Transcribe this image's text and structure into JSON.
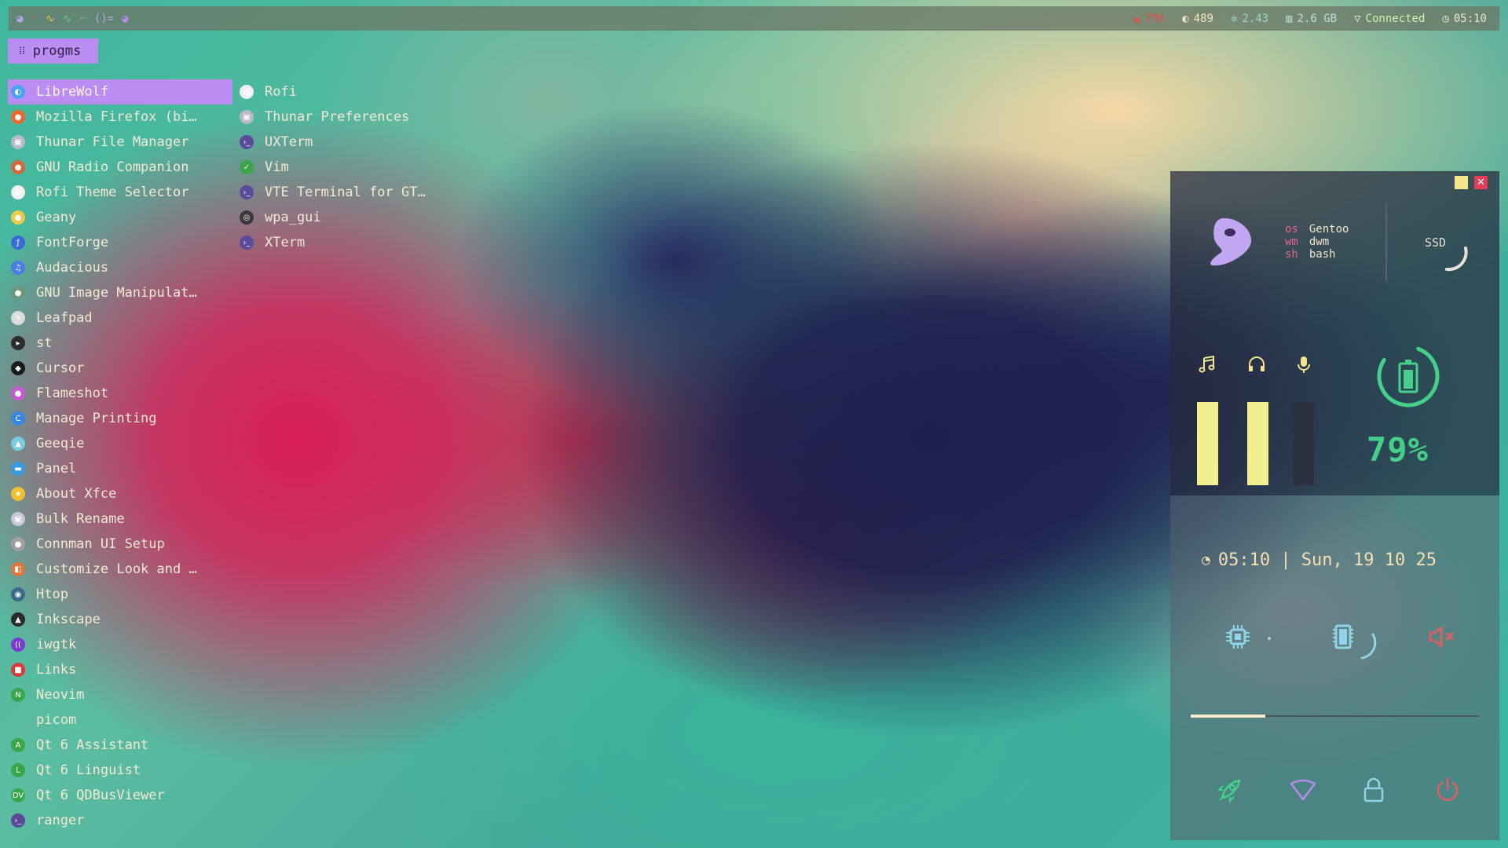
{
  "topbar": {
    "left_icons": [
      "gentoo-icon",
      "flame-icon",
      "wave-icon",
      "wave-icon",
      "pipe-icon",
      "brackets-icon",
      "gentoo-icon"
    ],
    "left_text": "⌐ ()=",
    "stats": [
      {
        "icon": "fire-icon",
        "value": "79%",
        "color": "#e24e4e"
      },
      {
        "icon": "half-moon-icon",
        "value": "489",
        "color": "#f2e6c2"
      },
      {
        "icon": "gear-icon",
        "value": "2.43",
        "color": "#9ad6cf"
      },
      {
        "icon": "memory-icon",
        "value": "2.6 GB",
        "color": "#f2e6c2"
      },
      {
        "icon": "wifi-icon",
        "value": "Connected",
        "color": "#d7f0b0"
      },
      {
        "icon": "clock-icon",
        "value": "05:10",
        "color": "#f2e6c2"
      }
    ]
  },
  "launcher": {
    "button_label": "progms",
    "col1": [
      {
        "label": "LibreWolf",
        "icon_color": "#4aa3f0",
        "selected": true
      },
      {
        "label": "Mozilla Firefox (bi…",
        "icon_color": "#e96a2a"
      },
      {
        "label": "Thunar File Manager",
        "icon_color": "#b9b9c9"
      },
      {
        "label": "GNU Radio Companion",
        "icon_color": "#d06a3a"
      },
      {
        "label": "Rofi Theme Selector",
        "icon_color": "#f0f0f0"
      },
      {
        "label": "Geany",
        "icon_color": "#f0c94a"
      },
      {
        "label": "FontForge",
        "icon_color": "#3a6ad6"
      },
      {
        "label": "Audacious",
        "icon_color": "#4a7ee0"
      },
      {
        "label": "GNU Image Manipulat…",
        "icon_color": "#6a9a7a"
      },
      {
        "label": "Leafpad",
        "icon_color": "#dcdcdc"
      },
      {
        "label": "st",
        "icon_color": "#2c2c2c"
      },
      {
        "label": "Cursor",
        "icon_color": "#1a1a1a"
      },
      {
        "label": "Flameshot",
        "icon_color": "#c85ad6"
      },
      {
        "label": "Manage Printing",
        "icon_color": "#3a86e6"
      },
      {
        "label": "Geeqie",
        "icon_color": "#7acae0"
      },
      {
        "label": "Panel",
        "icon_color": "#3a9ae0"
      },
      {
        "label": "About Xfce",
        "icon_color": "#f0c030"
      },
      {
        "label": "Bulk Rename",
        "icon_color": "#c8c8d6"
      },
      {
        "label": "Connman UI Setup",
        "icon_color": "#a0a0a0"
      },
      {
        "label": "Customize Look and …",
        "icon_color": "#e0763a"
      },
      {
        "label": "Htop",
        "icon_color": "#3a6a8a"
      },
      {
        "label": "Inkscape",
        "icon_color": "#2a2a2a"
      },
      {
        "label": "iwgtk",
        "icon_color": "#7a3ad6"
      },
      {
        "label": "Links",
        "icon_color": "#d63a3a"
      },
      {
        "label": "Neovim",
        "icon_color": "#3aa64a"
      },
      {
        "label": "picom",
        "icon_color": "transparent"
      },
      {
        "label": "Qt 6 Assistant",
        "icon_color": "#3aa64a"
      },
      {
        "label": "Qt 6 Linguist",
        "icon_color": "#3aa64a"
      },
      {
        "label": "Qt 6 QDBusViewer",
        "icon_color": "#3aa64a"
      },
      {
        "label": "ranger",
        "icon_color": "#5a4a9a"
      }
    ],
    "col1_glyphs": [
      "◐",
      "●",
      "▣",
      "●",
      "▦",
      "●",
      "ƒ",
      "♫",
      "●",
      "✎",
      "▸",
      "◆",
      "●",
      "C",
      "▲",
      "▬",
      "★",
      "▣",
      "●",
      "◧",
      "◉",
      "▲",
      "((",
      "■",
      "N",
      "",
      "A",
      "L",
      "DV",
      "›_"
    ],
    "col2": [
      {
        "label": "Rofi",
        "icon_color": "#f0f0f0"
      },
      {
        "label": "Thunar Preferences",
        "icon_color": "#b9b9c9"
      },
      {
        "label": "UXTerm",
        "icon_color": "#5a4a9a"
      },
      {
        "label": "Vim",
        "icon_color": "#3aa64a"
      },
      {
        "label": "VTE Terminal for GT…",
        "icon_color": "#5a4a9a"
      },
      {
        "label": "wpa_gui",
        "icon_color": "#3a3a3a"
      },
      {
        "label": "XTerm",
        "icon_color": "#5a4a9a"
      }
    ],
    "col2_glyphs": [
      "▦",
      "▣",
      "›_",
      "✓",
      "›_",
      "◎",
      "›_"
    ]
  },
  "widget": {
    "sysinfo": [
      {
        "key": "os",
        "value": "Gentoo"
      },
      {
        "key": "wm",
        "value": "dwm"
      },
      {
        "key": "sh",
        "value": "bash"
      }
    ],
    "ssd_label": "SSD",
    "battery_pct": "79%",
    "audio_icons": [
      "music-note-icon",
      "headphones-icon",
      "microphone-icon"
    ],
    "volume_levels": [
      1.0,
      1.0,
      0.0
    ],
    "clock_text": "05:10 | Sun, 19 10 25",
    "brightness_level": 0.26,
    "bottom_icons": [
      "rocket-icon",
      "wifi-icon",
      "lock-icon",
      "power-icon"
    ]
  }
}
